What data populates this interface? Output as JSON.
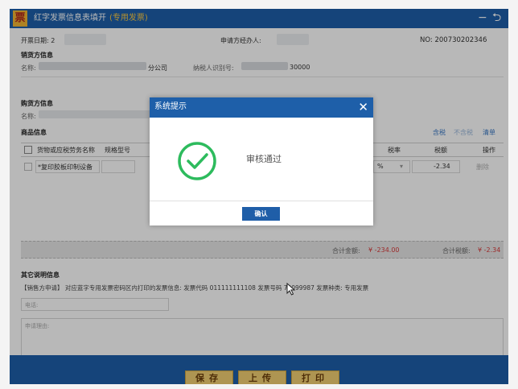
{
  "titlebar": {
    "icon_char": "票",
    "title": "红字发票信息表填开",
    "tag": "(专用发票)",
    "minimize": "−",
    "back": "⮌"
  },
  "form": {
    "issue_date_label": "开票日期: 2",
    "applicant_label": "申请方经办人:",
    "number": "NO: 200730202346",
    "seller_section": "销货方信息",
    "seller_name_label": "名称:",
    "seller_name_suffix": "分公司",
    "seller_tax_label": "纳税人识别号:",
    "seller_tax_suffix": "30000",
    "buyer_section": "购货方信息",
    "buyer_name_label": "名称:",
    "goods_section": "商品信息",
    "links": [
      "含税",
      "不含税",
      "清单"
    ],
    "columns": {
      "name": "货物或应税劳务名称",
      "spec": "规格型号",
      "rate": "税率",
      "tax": "税额",
      "op": "操作"
    },
    "row": {
      "name": "*复印胶板印制设备",
      "rate": "%",
      "tax": "-2.34",
      "op": "删除"
    },
    "total_amount_label": "合计金额:",
    "total_amount": "¥ -234.00",
    "total_tax_label": "合计税额:",
    "total_tax": "¥ -2.34",
    "other_section": "其它说明信息",
    "other_text": "【销售方申请】 对应蓝字专用发票密码区内打印的发票信息: 发票代码 011111111108 发票号码 79099987 发票种类: 专用发票",
    "phone_placeholder": "电话:",
    "reason_placeholder": "申请理由:"
  },
  "footer": {
    "save": "保存",
    "upload": "上传",
    "print": "打印"
  },
  "dialog": {
    "title": "系统提示",
    "close": "✕",
    "message": "审核通过",
    "ok": "确认"
  },
  "colors": {
    "primary": "#1e5fa9",
    "success": "#2dbb5d",
    "button_gold": "#f1cf72",
    "negative": "#d83b3b"
  },
  "icons": [
    "check-circle-icon",
    "close-icon",
    "back-icon",
    "minimize-icon",
    "checkbox-icon",
    "cursor-icon"
  ]
}
